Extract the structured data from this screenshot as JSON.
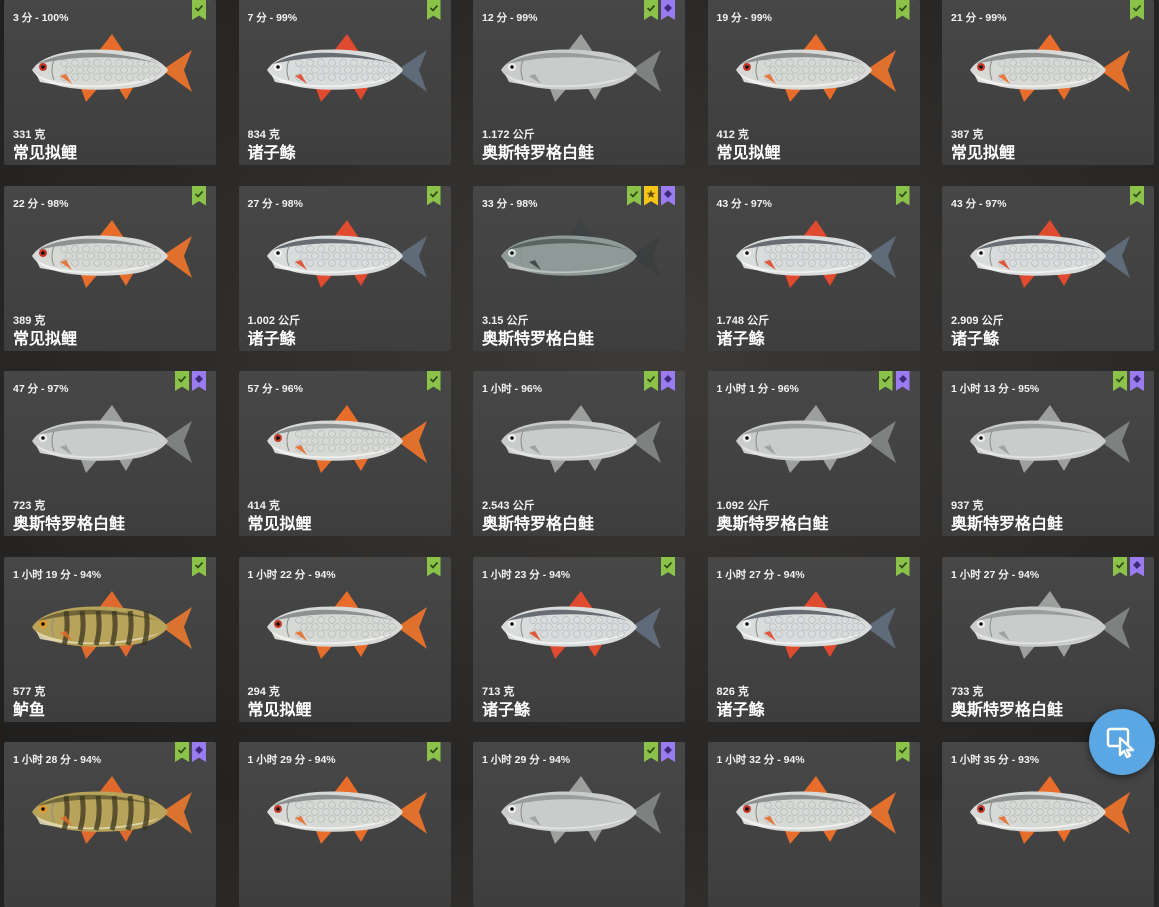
{
  "catches": [
    {
      "time": "3 分 - 100%",
      "weight": "331 克",
      "species": "常见拟鲤",
      "fish": "roach",
      "badges": [
        "check"
      ]
    },
    {
      "time": "7 分 - 99%",
      "weight": "834 克",
      "species": "诸子鲦",
      "fish": "ide",
      "badges": [
        "check"
      ]
    },
    {
      "time": "12 分 - 99%",
      "weight": "1.172 公斤",
      "species": "奥斯特罗格白鲑",
      "fish": "whitefish",
      "badges": [
        "check",
        "gem"
      ]
    },
    {
      "time": "19 分 - 99%",
      "weight": "412 克",
      "species": "常见拟鲤",
      "fish": "roach",
      "badges": [
        "check"
      ]
    },
    {
      "time": "21 分 - 99%",
      "weight": "387 克",
      "species": "常见拟鲤",
      "fish": "roach",
      "badges": [
        "check"
      ]
    },
    {
      "time": "22 分 - 98%",
      "weight": "389 克",
      "species": "常见拟鲤",
      "fish": "roach",
      "badges": [
        "check"
      ]
    },
    {
      "time": "27 分 - 98%",
      "weight": "1.002 公斤",
      "species": "诸子鲦",
      "fish": "ide",
      "badges": [
        "check"
      ]
    },
    {
      "time": "33 分 - 98%",
      "weight": "3.15 公斤",
      "species": "奥斯特罗格白鲑",
      "fish": "whitefish-dark",
      "badges": [
        "check",
        "star",
        "gem"
      ]
    },
    {
      "time": "43 分 - 97%",
      "weight": "1.748 公斤",
      "species": "诸子鲦",
      "fish": "ide",
      "badges": [
        "check"
      ]
    },
    {
      "time": "43 分 - 97%",
      "weight": "2.909 公斤",
      "species": "诸子鲦",
      "fish": "ide",
      "badges": [
        "check"
      ]
    },
    {
      "time": "47 分 - 97%",
      "weight": "723 克",
      "species": "奥斯特罗格白鲑",
      "fish": "whitefish",
      "badges": [
        "check",
        "gem"
      ]
    },
    {
      "time": "57 分 - 96%",
      "weight": "414 克",
      "species": "常见拟鲤",
      "fish": "roach",
      "badges": [
        "check"
      ]
    },
    {
      "time": "1 小时 - 96%",
      "weight": "2.543 公斤",
      "species": "奥斯特罗格白鲑",
      "fish": "whitefish",
      "badges": [
        "check",
        "gem"
      ]
    },
    {
      "time": "1 小时 1 分 - 96%",
      "weight": "1.092 公斤",
      "species": "奥斯特罗格白鲑",
      "fish": "whitefish",
      "badges": [
        "check",
        "gem"
      ]
    },
    {
      "time": "1 小时 13 分 - 95%",
      "weight": "937 克",
      "species": "奥斯特罗格白鲑",
      "fish": "whitefish",
      "badges": [
        "check",
        "gem"
      ]
    },
    {
      "time": "1 小时 19 分 - 94%",
      "weight": "577 克",
      "species": "鲈鱼",
      "fish": "perch",
      "badges": [
        "check"
      ]
    },
    {
      "time": "1 小时 22 分 - 94%",
      "weight": "294 克",
      "species": "常见拟鲤",
      "fish": "roach",
      "badges": [
        "check"
      ]
    },
    {
      "time": "1 小时 23 分 - 94%",
      "weight": "713 克",
      "species": "诸子鲦",
      "fish": "ide",
      "badges": [
        "check"
      ]
    },
    {
      "time": "1 小时 27 分 - 94%",
      "weight": "826 克",
      "species": "诸子鲦",
      "fish": "ide",
      "badges": [
        "check"
      ]
    },
    {
      "time": "1 小时 27 分 - 94%",
      "weight": "733 克",
      "species": "奥斯特罗格白鲑",
      "fish": "whitefish",
      "badges": [
        "check",
        "gem"
      ]
    },
    {
      "time": "1 小时 28 分 - 94%",
      "weight": "",
      "species": "",
      "fish": "perch",
      "badges": [
        "check",
        "gem"
      ]
    },
    {
      "time": "1 小时 29 分 - 94%",
      "weight": "",
      "species": "",
      "fish": "roach",
      "badges": [
        "check"
      ]
    },
    {
      "time": "1 小时 29 分 - 94%",
      "weight": "",
      "species": "",
      "fish": "whitefish",
      "badges": [
        "check",
        "gem"
      ]
    },
    {
      "time": "1 小时 32 分 - 94%",
      "weight": "",
      "species": "",
      "fish": "roach",
      "badges": [
        "check"
      ]
    },
    {
      "time": "1 小时 35 分 - 93%",
      "weight": "",
      "species": "",
      "fish": "roach",
      "badges": [
        "check"
      ]
    }
  ],
  "colors": {
    "check_badge": "#8bc34a",
    "gem_badge": "#9b7cf0",
    "star_badge": "#f5c518",
    "fab": "#5aa7e3"
  },
  "fab_icon": "cursor-click-icon"
}
